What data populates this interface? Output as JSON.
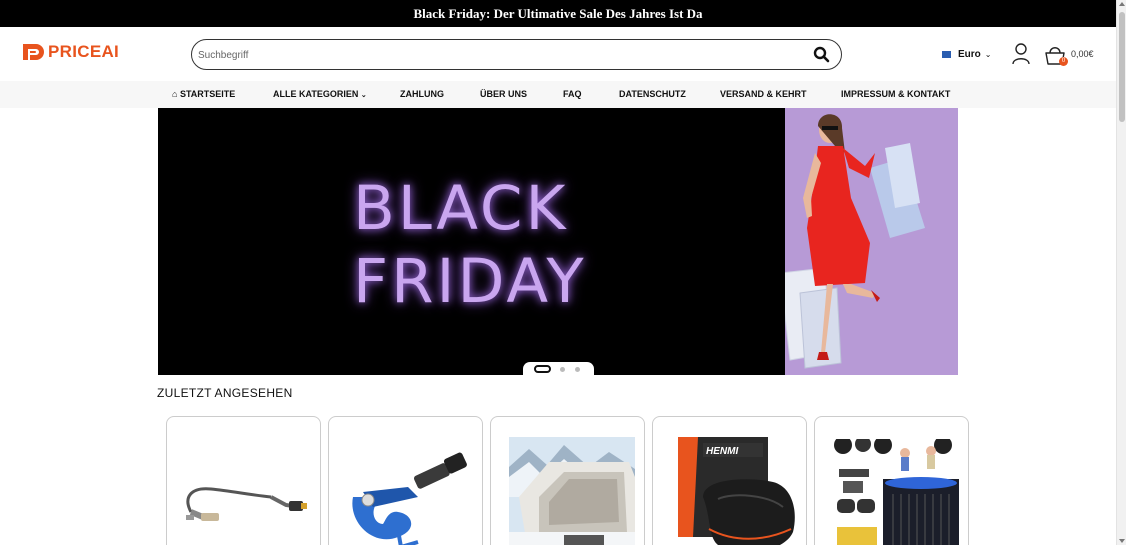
{
  "announcement": "Black Friday: Der Ultimative Sale Des Jahres Ist Da",
  "brand": {
    "name": "PRICEAI",
    "color": "#e8541e"
  },
  "search": {
    "placeholder": "Suchbegriff",
    "button_icon": "search-icon"
  },
  "currency": {
    "label": "Euro",
    "flag_color": "#2a5db0"
  },
  "account": {
    "icon": "user-icon"
  },
  "cart": {
    "icon": "cart-icon",
    "count": "0",
    "total": "0,00€"
  },
  "nav": {
    "home_icon": "home-icon",
    "items": [
      "STARTSEITE",
      "ALLE KATEGORIEN",
      "ZAHLUNG",
      "ÜBER UNS",
      "FAQ",
      "DATENSCHUTZ",
      "VERSAND & KEHRT",
      "IMPRESSUM & KONTAKT"
    ]
  },
  "hero": {
    "line1": "BLACK",
    "line2": "FRIDAY",
    "slides": 3,
    "active_slide": 1,
    "text_color": "#c9a6ef",
    "photo_bg": "#b79ad6"
  },
  "recently_viewed": {
    "title": "ZULETZT ANGESEHEN",
    "products": [
      {
        "image": "lambda-sensor-image"
      },
      {
        "image": "tube-cutter-image"
      },
      {
        "image": "caravan-windscreen-cover-image"
      },
      {
        "image": "bicycle-saddle-image"
      },
      {
        "image": "game-console-image"
      }
    ]
  }
}
